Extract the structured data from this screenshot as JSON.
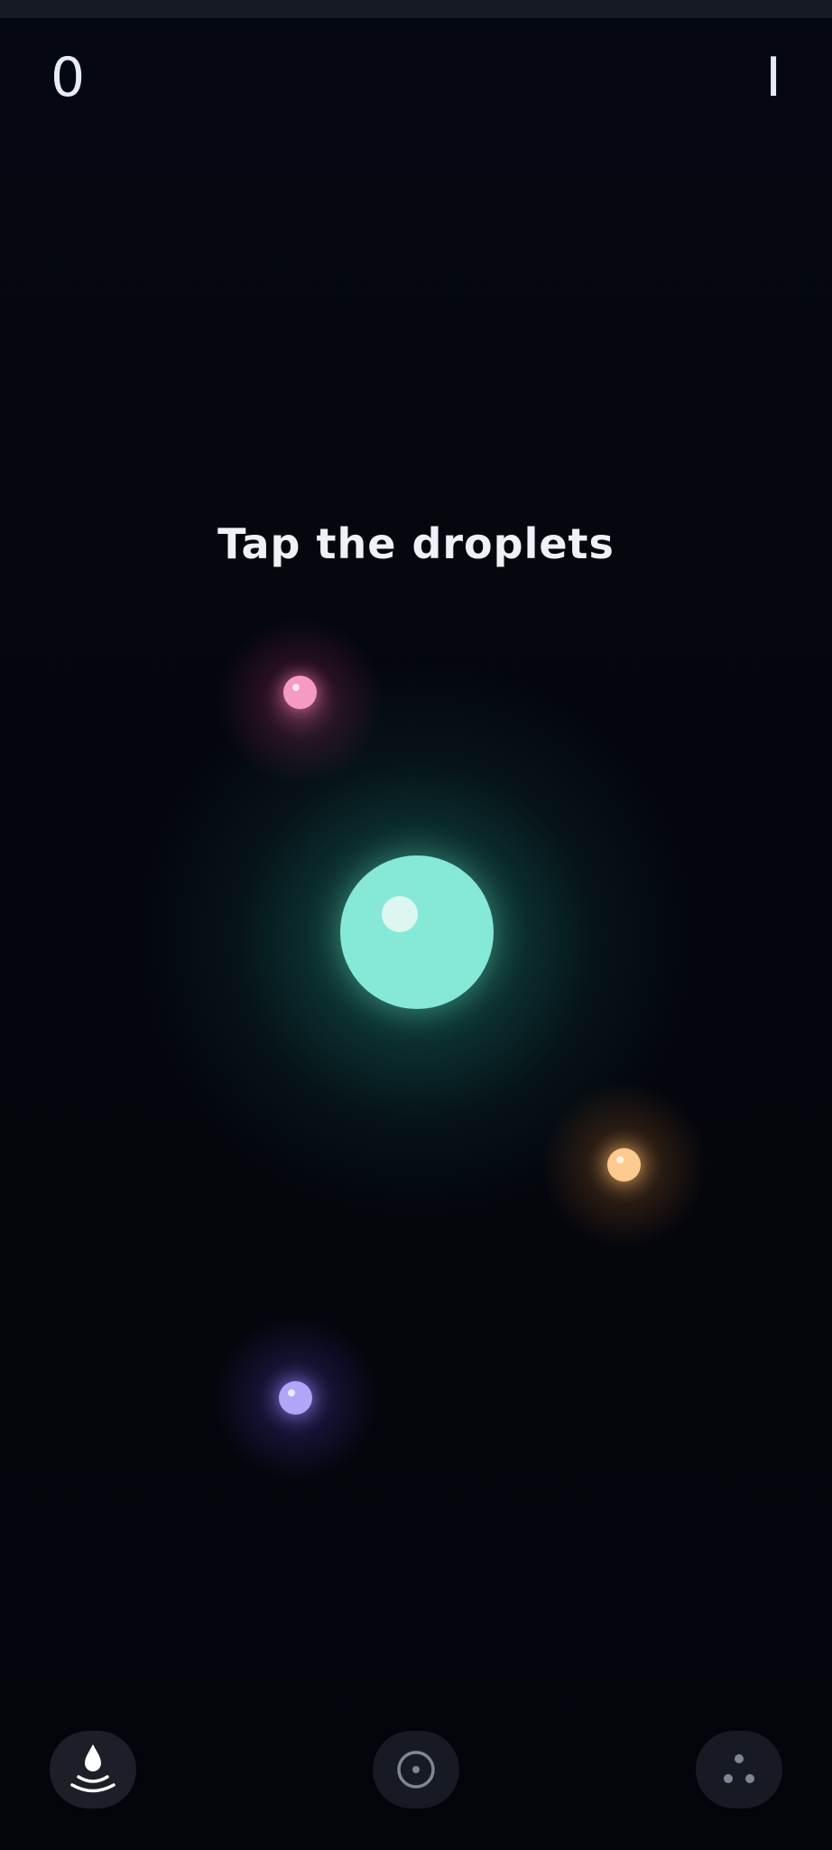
{
  "hud": {
    "score": "0",
    "level": "I"
  },
  "prompt": "Tap the droplets",
  "droplets": [
    {
      "name": "main",
      "color": "#86e8d6"
    },
    {
      "name": "pink",
      "color": "#f59ac0"
    },
    {
      "name": "orange",
      "color": "#fcc98f"
    },
    {
      "name": "violet",
      "color": "#b0a6f8"
    }
  ],
  "nav": {
    "items": [
      {
        "icon": "droplet-ripple-icon",
        "active": true
      },
      {
        "icon": "target-icon",
        "active": false
      },
      {
        "icon": "three-dots-icon",
        "active": false
      }
    ]
  },
  "colors": {
    "background": "#04060d",
    "text": "#eef1f7",
    "nav_button": "#171a22"
  }
}
